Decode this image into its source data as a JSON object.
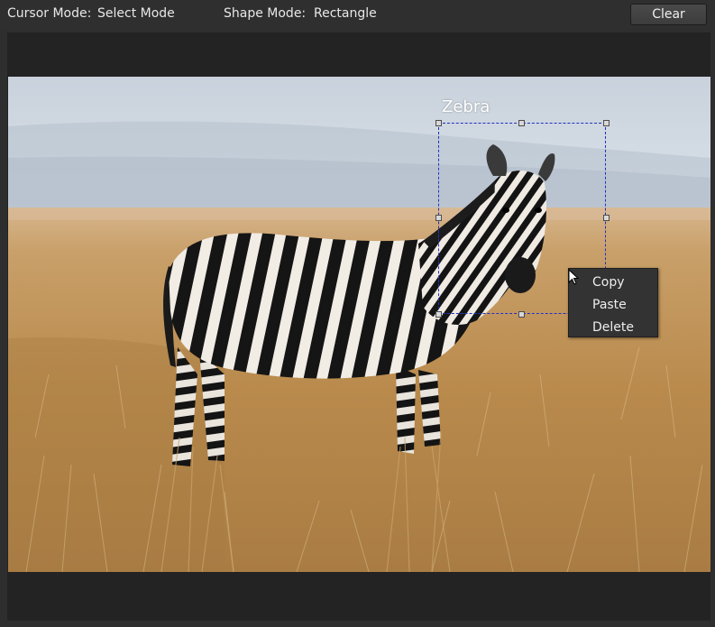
{
  "toolbar": {
    "cursor_mode_label": "Cursor Mode:",
    "cursor_mode_value": "Select Mode",
    "shape_mode_label": "Shape Mode:",
    "shape_mode_value": "Rectangle",
    "clear_label": "Clear"
  },
  "annotation": {
    "label": "Zebra"
  },
  "context_menu": {
    "items": [
      "Copy",
      "Paste",
      "Delete"
    ]
  },
  "icons": {
    "pointer": "mouse-pointer-icon"
  },
  "colors": {
    "toolbar_bg": "#2f2f2f",
    "canvas_bg": "#232323",
    "bbox_stroke": "#1f2fbd"
  }
}
